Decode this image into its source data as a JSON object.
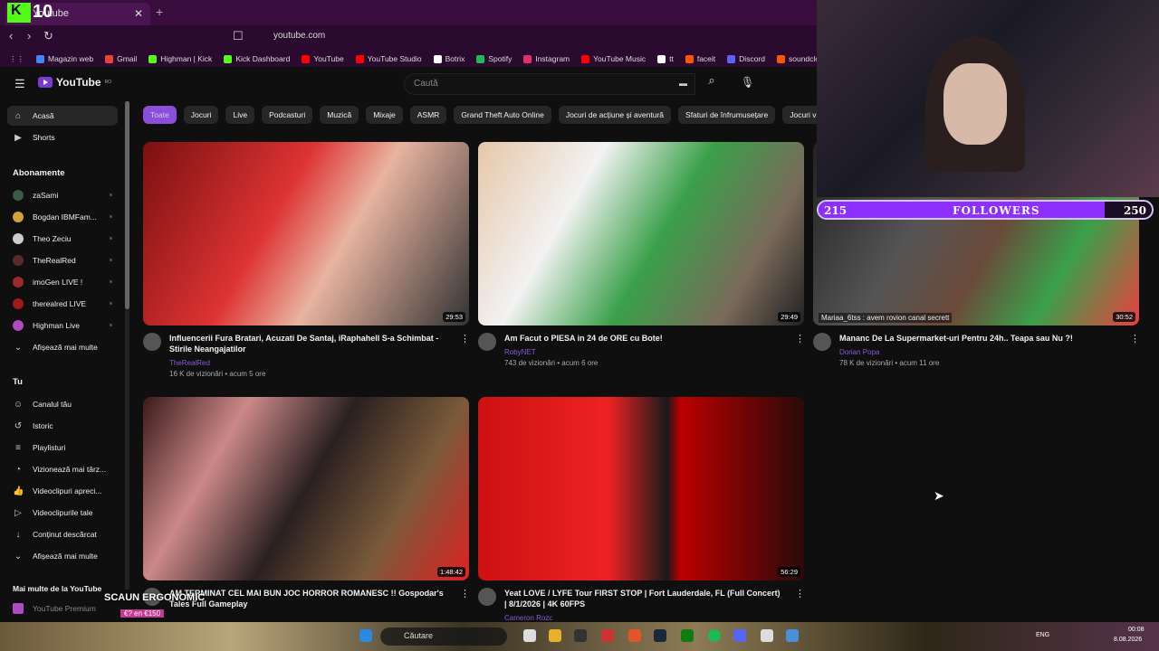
{
  "browser": {
    "overlay_logo": "10",
    "tab_title": "Youtube",
    "url": "youtube.com",
    "bookmarks": [
      {
        "label": "Magazin web",
        "color": "#4285f4"
      },
      {
        "label": "Gmail",
        "color": "#ea4335"
      },
      {
        "label": "Highman | Kick",
        "color": "#53fc18"
      },
      {
        "label": "Kick Dashboard",
        "color": "#53fc18"
      },
      {
        "label": "YouTube",
        "color": "#ff0000"
      },
      {
        "label": "YouTube Studio",
        "color": "#ff0000"
      },
      {
        "label": "Botrix",
        "color": "#ffffff"
      },
      {
        "label": "Spotify",
        "color": "#1db954"
      },
      {
        "label": "Instagram",
        "color": "#e1306c"
      },
      {
        "label": "YouTube Music",
        "color": "#ff0000"
      },
      {
        "label": "tt",
        "color": "#ffffff"
      },
      {
        "label": "faceit",
        "color": "#ff5500"
      },
      {
        "label": "Discord",
        "color": "#5865f2"
      },
      {
        "label": "soundcloud.com/",
        "color": "#ff5500"
      }
    ]
  },
  "youtube": {
    "logo_text": "YouTube",
    "logo_country": "RO",
    "search_placeholder": "Caută",
    "accent": "#8a4fd8",
    "sidebar": {
      "main": [
        {
          "label": "Acasă",
          "icon": "home-icon"
        },
        {
          "label": "Shorts",
          "icon": "shorts-icon"
        }
      ],
      "subscriptions_header": "Abonamente",
      "subscriptions": [
        {
          "label": "zaSami",
          "color": "#3a5a4a"
        },
        {
          "label": "Bogdan IBMFam...",
          "color": "#d4a23a"
        },
        {
          "label": "Theo Zeciu",
          "color": "#cccccc"
        },
        {
          "label": "TheRealRed",
          "color": "#5a2a2a"
        },
        {
          "label": "imoGen LIVE !",
          "color": "#9a2a2a"
        },
        {
          "label": "therealred LIVE",
          "color": "#a01a1a"
        },
        {
          "label": "Highman Live",
          "color": "#b04ac0"
        },
        {
          "label": "Afișează mai multe",
          "color": ""
        }
      ],
      "you_header": "Tu",
      "you": [
        {
          "label": "Canalul tău",
          "icon": "channel-icon"
        },
        {
          "label": "Istoric",
          "icon": "history-icon"
        },
        {
          "label": "Playlisturi",
          "icon": "playlist-icon"
        },
        {
          "label": "Vizionează mai târz...",
          "icon": "watch-later-icon"
        },
        {
          "label": "Videoclipuri apreci...",
          "icon": "like-icon"
        },
        {
          "label": "Videoclipurile tale",
          "icon": "your-videos-icon"
        },
        {
          "label": "Conținut descărcat",
          "icon": "download-icon"
        },
        {
          "label": "Afișează mai multe",
          "icon": "chevron-down-icon"
        }
      ],
      "more_header": "Mai multe de la YouTube",
      "premium": "YouTube Premium"
    },
    "chips": [
      "Toate",
      "Jocuri",
      "Live",
      "Podcasturi",
      "Muzică",
      "Mixaje",
      "ASMR",
      "Grand Theft Auto Online",
      "Jocuri de acțiune și aventură",
      "Sfaturi de înfrumusețare",
      "Jocuri video d"
    ],
    "videos": [
      {
        "title": "Influencerii Fura Bratari, Acuzati De Santaj, iRaphahell S-a Schimbat - Stirile Neangajatilor",
        "channel": "TheRealRed",
        "meta": "16 K de vizionări • acum 5 ore",
        "duration": "29:53",
        "bg": "linear-gradient(120deg,#7a1010,#d33 40%,#e8b4a0 60%,#333)"
      },
      {
        "title": "Am Facut o PIESA in 24 de ORE cu Bote!",
        "channel": "RobyNET",
        "meta": "743 de vizionări • acum 6 ore",
        "duration": "29:49",
        "bg": "linear-gradient(120deg,#e6c7a8,#f2f2f2 30%,#3aa04a 55%,#7a6a5a 80%,#222)"
      },
      {
        "title": "Mananc De La Supermarket-uri Pentru 24h.. Teapa sau Nu ?!",
        "channel": "Dorian Popa",
        "meta": "78 K de vizionări • acum 11 ore",
        "duration": "30:52",
        "bg": "linear-gradient(120deg,#222,#555 35%,#6a4a3a 55%,#3aa04a 75%,#e94040)"
      },
      {
        "title": "AM TERMINAT CEL MAI BUN JOC HORROR ROMANESC !! Gospodar's Tales Full Gameplay",
        "channel": "",
        "meta": "",
        "duration": "1:48:42",
        "bg": "linear-gradient(120deg,#3a1a1a,#c88 25%,#2a2020 50%,#7a5a3a 75%,#d22)"
      },
      {
        "title": "Yeat LOVE / LYFE Tour FIRST STOP | Fort Lauderdale, FL (Full Concert) | 8/1/2026 | 4K 60FPS",
        "channel": "Cameron Rozc",
        "meta": "",
        "duration": "56:29",
        "bg": "linear-gradient(90deg,#c11 0%,#e22 40%,#1a1a1a 58%,#b00 62%,#2a0a0a 100%)"
      }
    ]
  },
  "stream_overlay": {
    "followers_label": "FOLLOWERS",
    "followers_current": "215",
    "followers_goal": "250",
    "followers_fraction": 0.86,
    "chat_line": "Mariaa_6tss : avem rovion canal secrett",
    "promo_title": "SCAUN ERGONOMIC",
    "promo_price": "€? en €150"
  },
  "taskbar": {
    "search_label": "Căutare",
    "lang": "ENG",
    "time": "00:08",
    "date": "8.08.2026"
  }
}
